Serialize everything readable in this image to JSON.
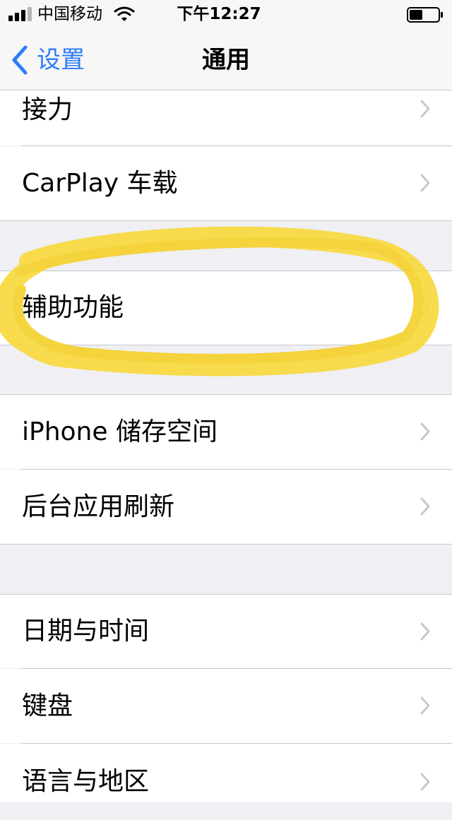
{
  "status_bar": {
    "carrier": "中国移动",
    "time": "下午12:27"
  },
  "nav": {
    "back_label": "设置",
    "title": "通用"
  },
  "rows": [
    {
      "label": "接力"
    },
    {
      "label": "CarPlay 车载"
    },
    {
      "label": "辅助功能"
    },
    {
      "label": "iPhone 储存空间"
    },
    {
      "label": "后台应用刷新"
    },
    {
      "label": "日期与时间"
    },
    {
      "label": "键盘"
    },
    {
      "label": "语言与地区"
    }
  ],
  "colors": {
    "accent": "#2f7cf6",
    "highlight": "#f8d93a",
    "group_background": "#efeff4"
  },
  "icons": {
    "back": "chevron-left-icon",
    "row": "chevron-right-icon",
    "wifi": "wifi-icon",
    "signal": "signal-icon",
    "battery": "battery-icon"
  }
}
